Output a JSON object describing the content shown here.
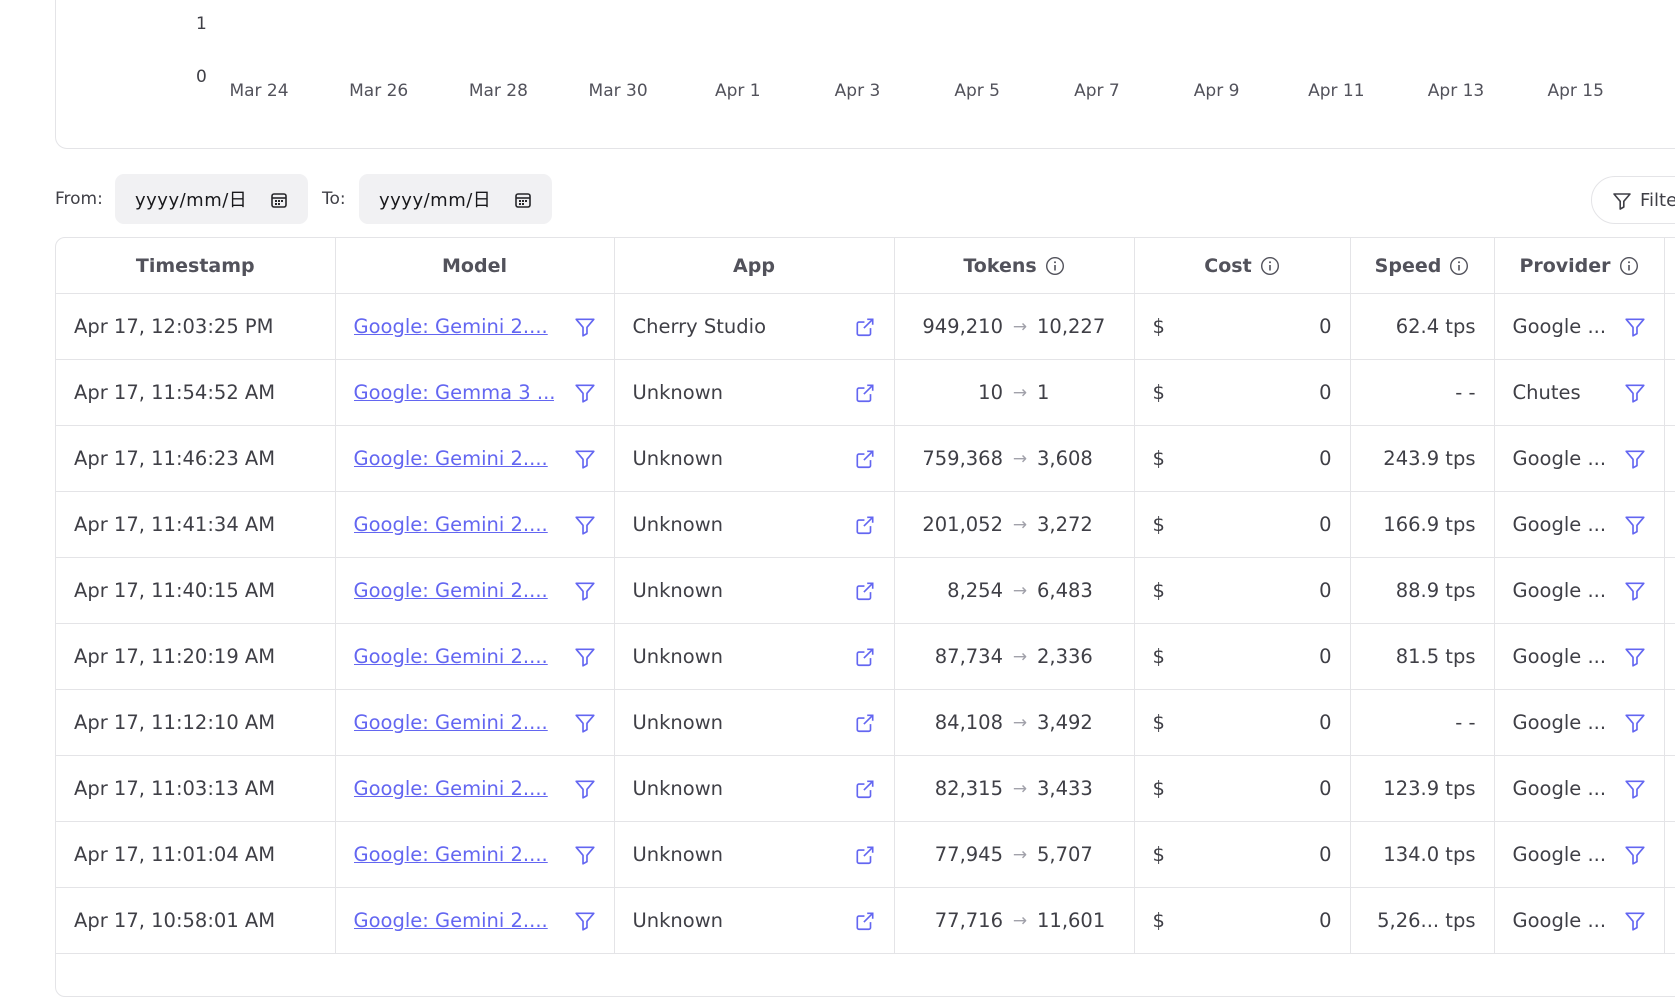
{
  "chart": {
    "y_ticks": [
      "1",
      "0"
    ],
    "x_ticks": [
      "Mar 24",
      "Mar 26",
      "Mar 28",
      "Mar 30",
      "Apr 1",
      "Apr 3",
      "Apr 5",
      "Apr 7",
      "Apr 9",
      "Apr 11",
      "Apr 13",
      "Apr 15"
    ]
  },
  "filters": {
    "from_label": "From:",
    "from_placeholder": "yyyy/mm/日",
    "to_label": "To:",
    "to_placeholder": "yyyy/mm/日",
    "filter_button": "Filter"
  },
  "table": {
    "headers": {
      "timestamp": "Timestamp",
      "model": "Model",
      "app": "App",
      "tokens": "Tokens",
      "cost": "Cost",
      "speed": "Speed",
      "provider": "Provider"
    },
    "rows": [
      {
        "timestamp": "Apr 17, 12:03:25 PM",
        "model": "Google: Gemini 2....",
        "app": "Cherry Studio",
        "tokens_in": "949,210",
        "tokens_out": "10,227",
        "cost_symbol": "$",
        "cost": "0",
        "speed": "62.4 tps",
        "provider": "Google ..."
      },
      {
        "timestamp": "Apr 17, 11:54:52 AM",
        "model": "Google: Gemma 3 ...",
        "app": "Unknown",
        "tokens_in": "10",
        "tokens_out": "1",
        "cost_symbol": "$",
        "cost": "0",
        "speed": "- -",
        "provider": "Chutes"
      },
      {
        "timestamp": "Apr 17, 11:46:23 AM",
        "model": "Google: Gemini 2....",
        "app": "Unknown",
        "tokens_in": "759,368",
        "tokens_out": "3,608",
        "cost_symbol": "$",
        "cost": "0",
        "speed": "243.9 tps",
        "provider": "Google ..."
      },
      {
        "timestamp": "Apr 17, 11:41:34 AM",
        "model": "Google: Gemini 2....",
        "app": "Unknown",
        "tokens_in": "201,052",
        "tokens_out": "3,272",
        "cost_symbol": "$",
        "cost": "0",
        "speed": "166.9 tps",
        "provider": "Google ..."
      },
      {
        "timestamp": "Apr 17, 11:40:15 AM",
        "model": "Google: Gemini 2....",
        "app": "Unknown",
        "tokens_in": "8,254",
        "tokens_out": "6,483",
        "cost_symbol": "$",
        "cost": "0",
        "speed": "88.9 tps",
        "provider": "Google ..."
      },
      {
        "timestamp": "Apr 17, 11:20:19 AM",
        "model": "Google: Gemini 2....",
        "app": "Unknown",
        "tokens_in": "87,734",
        "tokens_out": "2,336",
        "cost_symbol": "$",
        "cost": "0",
        "speed": "81.5 tps",
        "provider": "Google ..."
      },
      {
        "timestamp": "Apr 17, 11:12:10 AM",
        "model": "Google: Gemini 2....",
        "app": "Unknown",
        "tokens_in": "84,108",
        "tokens_out": "3,492",
        "cost_symbol": "$",
        "cost": "0",
        "speed": "- -",
        "provider": "Google ..."
      },
      {
        "timestamp": "Apr 17, 11:03:13 AM",
        "model": "Google: Gemini 2....",
        "app": "Unknown",
        "tokens_in": "82,315",
        "tokens_out": "3,433",
        "cost_symbol": "$",
        "cost": "0",
        "speed": "123.9 tps",
        "provider": "Google ..."
      },
      {
        "timestamp": "Apr 17, 11:01:04 AM",
        "model": "Google: Gemini 2....",
        "app": "Unknown",
        "tokens_in": "77,945",
        "tokens_out": "5,707",
        "cost_symbol": "$",
        "cost": "0",
        "speed": "134.0 tps",
        "provider": "Google ..."
      },
      {
        "timestamp": "Apr 17, 10:58:01 AM",
        "model": "Google: Gemini 2....",
        "app": "Unknown",
        "tokens_in": "77,716",
        "tokens_out": "11,601",
        "cost_symbol": "$",
        "cost": "0",
        "speed": "5,26... tps",
        "provider": "Google ..."
      }
    ]
  },
  "colors": {
    "link": "#6366f1",
    "border": "#e4e4e7",
    "input_bg": "#f1f1f3"
  }
}
